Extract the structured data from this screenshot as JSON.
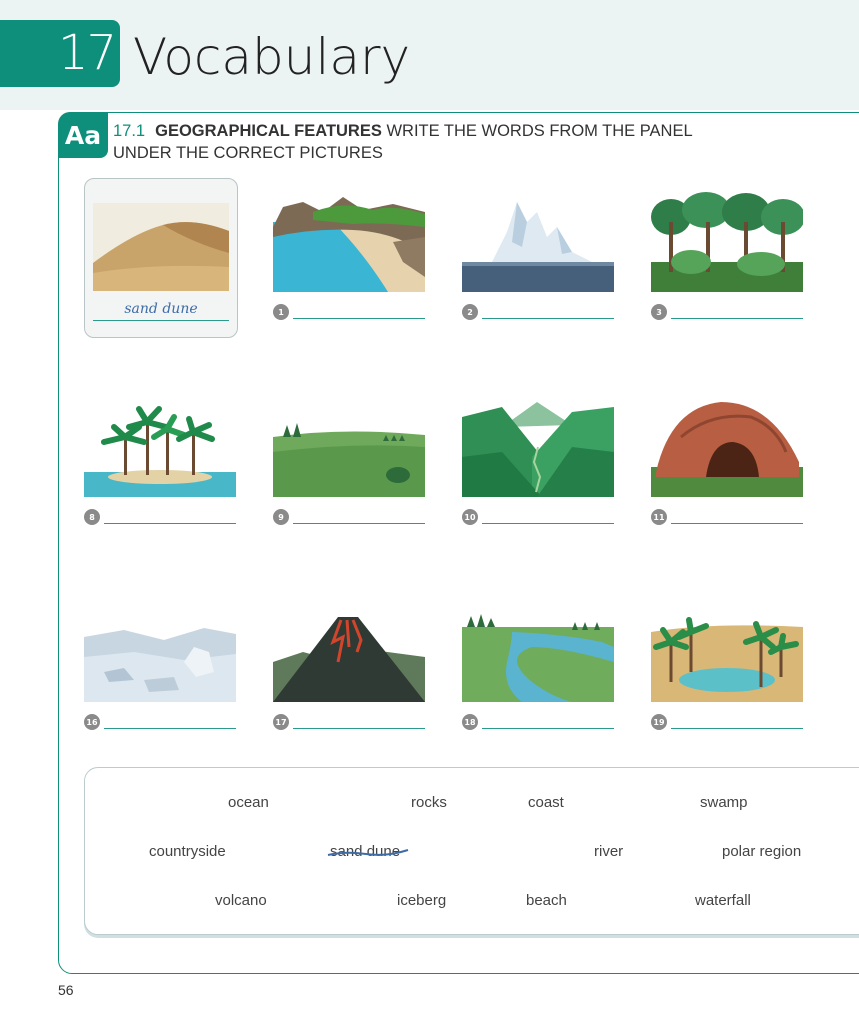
{
  "chapter": {
    "number": "17",
    "title": "Vocabulary"
  },
  "exercise": {
    "badge": "Aa",
    "number": "17.1",
    "title": "GEOGRAPHICAL FEATURES",
    "instruction_line1": "WRITE THE WORDS FROM THE PANEL",
    "instruction_line2": "UNDER THE CORRECT PICTURES"
  },
  "example": {
    "answer": "sand dune",
    "picture": "desert-sand-dune"
  },
  "items": [
    {
      "number": "1",
      "picture": "coastline"
    },
    {
      "number": "2",
      "picture": "iceberg"
    },
    {
      "number": "3",
      "picture": "jungle"
    },
    {
      "number": "8",
      "picture": "tropical-island"
    },
    {
      "number": "9",
      "picture": "meadow"
    },
    {
      "number": "10",
      "picture": "valley"
    },
    {
      "number": "11",
      "picture": "cave"
    },
    {
      "number": "16",
      "picture": "polar-landscape"
    },
    {
      "number": "17",
      "picture": "volcano"
    },
    {
      "number": "18",
      "picture": "river"
    },
    {
      "number": "19",
      "picture": "oasis"
    }
  ],
  "word_panel": {
    "words": [
      "ocean",
      "rocks",
      "coast",
      "swamp",
      "countryside",
      "river",
      "polar region",
      "volcano",
      "iceberg",
      "beach",
      "waterfall"
    ],
    "crossed_out": "sand dune"
  },
  "page_number": "56",
  "colors": {
    "accent": "#0e8f7c",
    "answer_ink": "#3d6ca7"
  }
}
